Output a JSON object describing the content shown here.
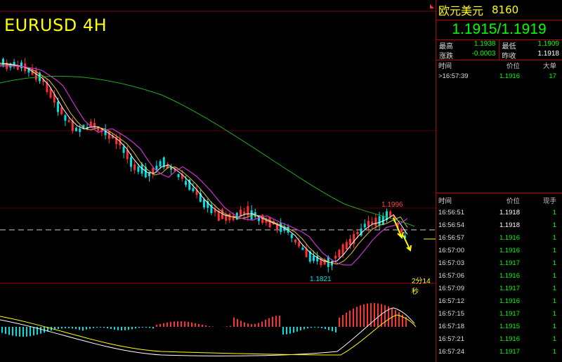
{
  "chart": {
    "symbol_title": "EURUSD 4H",
    "high_label": "1.1996",
    "low_label": "1.1821",
    "countdown": "2分14秒",
    "colors": {
      "background": "#000000",
      "up": "#00e0e0",
      "down": "#ff3030",
      "ma_fast": "#ffffff",
      "ma_mid": "#e0c040",
      "ma_slow": "#cc33cc",
      "ma_long": "#22aa22",
      "arrow": "#ffff00",
      "macd_pos": "#ff3030",
      "macd_neg": "#00e0e0",
      "dif": "#ffffff",
      "dea": "#ffff00"
    }
  },
  "panel": {
    "name": "欧元美元",
    "code": "8160",
    "quote": "1.1915/1.1919",
    "stats": {
      "high_label": "最高",
      "high_value": "1.1938",
      "low_label": "最低",
      "low_value": "1.1909",
      "change_label": "涨跌",
      "change_value": "-0.0003",
      "prev_close_label": "昨收",
      "prev_close_value": "1.1918"
    },
    "big_orders": {
      "headers": [
        "时间",
        "价位",
        "大单"
      ],
      "rows": [
        {
          "time": ">16:57:39",
          "price": "1.1916",
          "vol": "17"
        }
      ]
    },
    "ticks": {
      "headers": [
        "时间",
        "价位",
        "现手"
      ],
      "rows": [
        {
          "time": "16:56:51",
          "price": "1.1918",
          "vol": "1",
          "color": "w"
        },
        {
          "time": "16:56:54",
          "price": "1.1918",
          "vol": "1",
          "color": "w"
        },
        {
          "time": "16:56:57",
          "price": "1.1916",
          "vol": "1",
          "color": "g"
        },
        {
          "time": "16:57:00",
          "price": "1.1916",
          "vol": "1",
          "color": "g"
        },
        {
          "time": "16:57:03",
          "price": "1.1917",
          "vol": "1",
          "color": "g"
        },
        {
          "time": "16:57:06",
          "price": "1.1916",
          "vol": "1",
          "color": "g"
        },
        {
          "time": "16:57:09",
          "price": "1.1917",
          "vol": "1",
          "color": "g"
        },
        {
          "time": "16:57:12",
          "price": "1.1916",
          "vol": "1",
          "color": "g"
        },
        {
          "time": "16:57:15",
          "price": "1.1917",
          "vol": "1",
          "color": "g"
        },
        {
          "time": "16:57:18",
          "price": "1.1915",
          "vol": "1",
          "color": "g"
        },
        {
          "time": "16:57:21",
          "price": "1.1916",
          "vol": "1",
          "color": "g"
        },
        {
          "time": "16:57:24",
          "price": "1.1917",
          "vol": "1",
          "color": "g"
        }
      ]
    }
  }
}
